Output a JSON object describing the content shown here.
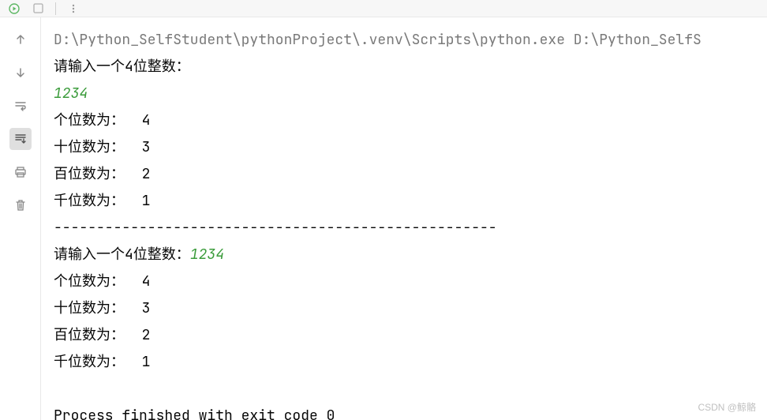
{
  "toolbar": {
    "run_icon": "run",
    "stop_icon": "stop",
    "more_icon": "more"
  },
  "sidebar": {
    "items": [
      {
        "name": "up-arrow"
      },
      {
        "name": "down-arrow"
      },
      {
        "name": "soft-wrap"
      },
      {
        "name": "scroll-to-end"
      },
      {
        "name": "print"
      },
      {
        "name": "trash"
      }
    ]
  },
  "console": {
    "command": "D:\\Python_SelfStudent\\pythonProject\\.venv\\Scripts\\python.exe D:\\Python_SelfS",
    "prompt1": "请输入一个4位整数：",
    "input1": "1234",
    "digit_ones_label": "个位数为：  ",
    "digit_ones_value": "4",
    "digit_tens_label": "十位数为：  ",
    "digit_tens_value": "3",
    "digit_hundreds_label": "百位数为：  ",
    "digit_hundreds_value": "2",
    "digit_thousands_label": "千位数为：  ",
    "digit_thousands_value": "1",
    "separator": "----------------------------------------------------",
    "prompt2": "请输入一个4位整数：",
    "input2": "1234",
    "digit2_ones_label": "个位数为：  ",
    "digit2_ones_value": "4",
    "digit2_tens_label": "十位数为：  ",
    "digit2_tens_value": "3",
    "digit2_hundreds_label": "百位数为：  ",
    "digit2_hundreds_value": "2",
    "digit2_thousands_label": "千位数为：  ",
    "digit2_thousands_value": "1",
    "exit_message": "Process finished with exit code 0"
  },
  "watermark": "CSDN @鲸骼"
}
